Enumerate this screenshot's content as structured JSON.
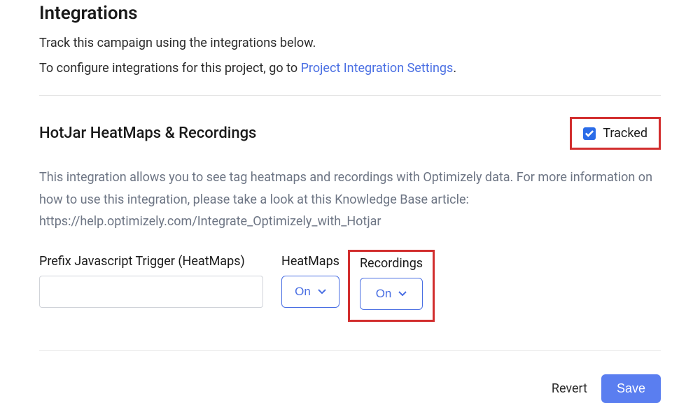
{
  "page": {
    "title": "Integrations",
    "subtitle": "Track this campaign using the integrations below.",
    "config_prefix": "To configure integrations for this project, go to ",
    "config_link": "Project Integration Settings",
    "config_suffix": "."
  },
  "integration": {
    "title": "HotJar HeatMaps & Recordings",
    "tracked_label": "Tracked",
    "tracked_checked": true,
    "description": "This integration allows you to see tag heatmaps and recordings with Optimizely data. For more information on how to use this integration, please take a look at this Knowledge Base article: https://help.optimizely.com/Integrate_Optimizely_with_Hotjar",
    "fields": {
      "prefix_label": "Prefix Javascript Trigger (HeatMaps)",
      "prefix_value": "",
      "heatmaps_label": "HeatMaps",
      "heatmaps_value": "On",
      "recordings_label": "Recordings",
      "recordings_value": "On"
    }
  },
  "footer": {
    "revert_label": "Revert",
    "save_label": "Save"
  }
}
